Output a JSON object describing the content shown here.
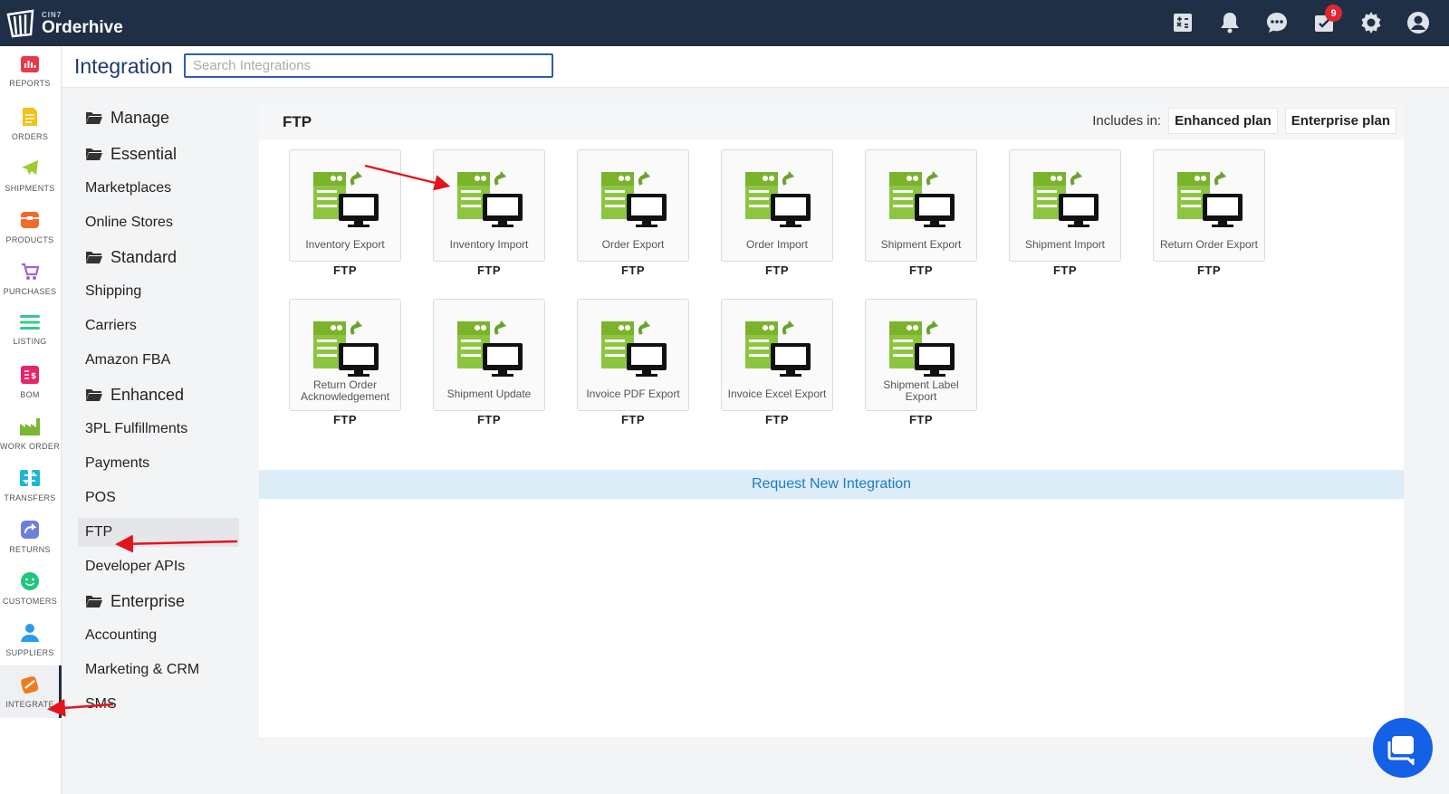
{
  "app": {
    "brand_sub": "CIN7",
    "brand_name": "Orderhive",
    "notification_count": "9"
  },
  "nav": [
    {
      "label": "REPORTS",
      "icon": "bar-chart-icon",
      "color": "#e8394a"
    },
    {
      "label": "ORDERS",
      "icon": "document-icon",
      "color": "#f5c11b"
    },
    {
      "label": "SHIPMENTS",
      "icon": "airplane-icon",
      "color": "#9ccc2f"
    },
    {
      "label": "PRODUCTS",
      "icon": "box-icon",
      "color": "#f06a2a"
    },
    {
      "label": "PURCHASES",
      "icon": "cart-icon",
      "color": "#a064d6"
    },
    {
      "label": "LISTING",
      "icon": "list-icon",
      "color": "#38c98a"
    },
    {
      "label": "BOM",
      "icon": "bom-icon",
      "color": "#e8246a"
    },
    {
      "label": "WORK ORDER",
      "icon": "factory-icon",
      "color": "#7ab735"
    },
    {
      "label": "TRANSFERS",
      "icon": "transfer-icon",
      "color": "#1fb6d6"
    },
    {
      "label": "RETURNS",
      "icon": "return-icon",
      "color": "#6c7fd8"
    },
    {
      "label": "CUSTOMERS",
      "icon": "smiley-icon",
      "color": "#1fc77a"
    },
    {
      "label": "SUPPLIERS",
      "icon": "person-icon",
      "color": "#2b9bf0"
    },
    {
      "label": "INTEGRATE",
      "icon": "integrate-icon",
      "color": "#f07b1c"
    }
  ],
  "header": {
    "title": "Integration",
    "search_placeholder": "Search Integrations"
  },
  "categories": [
    {
      "label": "Manage",
      "group": true
    },
    {
      "label": "Essential",
      "group": true
    },
    {
      "label": "Marketplaces",
      "group": false
    },
    {
      "label": "Online Stores",
      "group": false
    },
    {
      "label": "Standard",
      "group": true
    },
    {
      "label": "Shipping",
      "group": false
    },
    {
      "label": "Carriers",
      "group": false
    },
    {
      "label": "Amazon FBA",
      "group": false
    },
    {
      "label": "Enhanced",
      "group": true
    },
    {
      "label": "3PL Fulfillments",
      "group": false
    },
    {
      "label": "Payments",
      "group": false
    },
    {
      "label": "POS",
      "group": false
    },
    {
      "label": "FTP",
      "group": false,
      "active": true
    },
    {
      "label": "Developer APIs",
      "group": false
    },
    {
      "label": "Enterprise",
      "group": true
    },
    {
      "label": "Accounting",
      "group": false
    },
    {
      "label": "Marketing & CRM",
      "group": false
    },
    {
      "label": "SMS",
      "group": false
    }
  ],
  "content": {
    "title": "FTP",
    "includes_label": "Includes in:",
    "plans": [
      "Enhanced plan",
      "Enterprise plan"
    ],
    "request_label": "Request New Integration",
    "tiles": [
      {
        "name": "Inventory Export",
        "caption": "FTP"
      },
      {
        "name": "Inventory Import",
        "caption": "FTP"
      },
      {
        "name": "Order Export",
        "caption": "FTP"
      },
      {
        "name": "Order Import",
        "caption": "FTP"
      },
      {
        "name": "Shipment Export",
        "caption": "FTP"
      },
      {
        "name": "Shipment Import",
        "caption": "FTP"
      },
      {
        "name": "Return Order Export",
        "caption": "FTP"
      },
      {
        "name": "Return Order Acknowledgement",
        "caption": "FTP"
      },
      {
        "name": "Shipment Update",
        "caption": "FTP"
      },
      {
        "name": "Invoice PDF Export",
        "caption": "FTP"
      },
      {
        "name": "Invoice Excel Export",
        "caption": "FTP"
      },
      {
        "name": "Shipment Label Export",
        "caption": "FTP"
      }
    ]
  }
}
